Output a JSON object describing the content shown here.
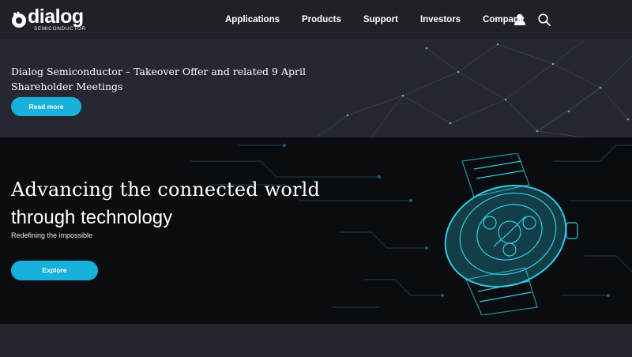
{
  "brand": {
    "name": "dialog",
    "tagline": "SEMICONDUCTOR",
    "accent": "#18b1dc"
  },
  "nav": {
    "items": [
      "Applications",
      "Products",
      "Support",
      "Investors",
      "Company"
    ],
    "user_icon": "user-icon",
    "search_icon": "search-icon"
  },
  "announcement": {
    "title": "Dialog Semiconductor – Takeover Offer and related 9 April Shareholder Meetings",
    "button": "Read more"
  },
  "hero": {
    "title_line1": "Advancing the connected world",
    "title_line2": "through technology",
    "subtitle": "Redefining the impossible",
    "button": "Explore"
  }
}
